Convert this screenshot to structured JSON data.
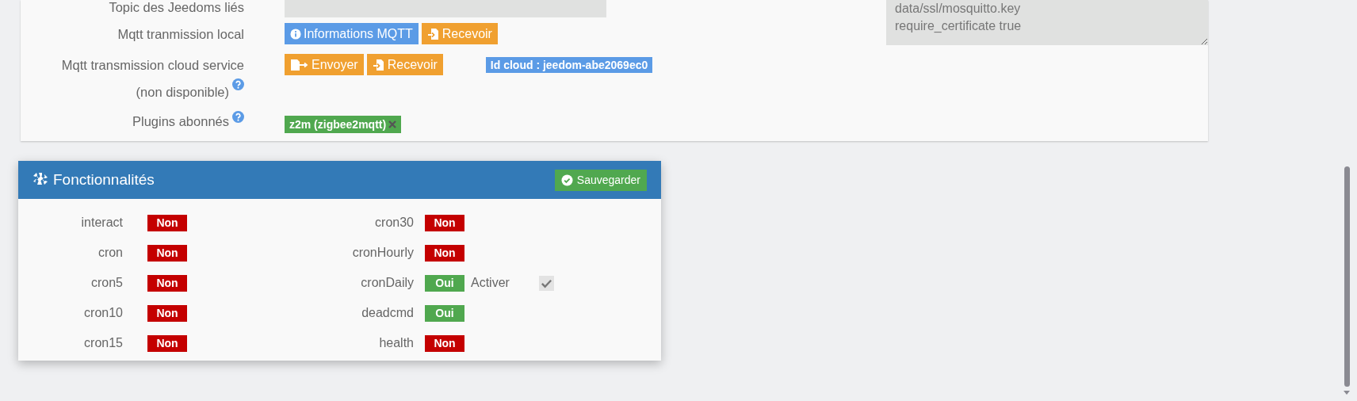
{
  "config": {
    "rows": [
      {
        "kind": "field",
        "label": "Topic des Jeedoms liés"
      },
      {
        "kind": "buttons",
        "label": "Mqtt tranmission local",
        "help": false,
        "buttons": [
          {
            "label": "Informations MQTT",
            "kind": "info"
          },
          {
            "label": "Recevoir",
            "kind": "receive"
          }
        ]
      },
      {
        "kind": "buttons",
        "label": "Mqtt transmission cloud service (non disponible)",
        "help": true,
        "buttons": [
          {
            "label": "Envoyer",
            "kind": "send"
          },
          {
            "label": "Recevoir",
            "kind": "receive"
          }
        ],
        "badge": "Id cloud : jeedom-abe2069ec0"
      },
      {
        "kind": "tags",
        "label": "Plugins abonnés",
        "help": true,
        "tags": [
          "z2m (zigbee2mqtt)"
        ]
      }
    ],
    "textarea": "data/ssl/mosquitto.key\nrequire_certificate true"
  },
  "features": {
    "title": "Fonctionnalités",
    "save_button": "Sauvegarder",
    "columns": [
      [
        {
          "name": "interact",
          "value": "Non",
          "enabled": false
        },
        {
          "name": "cron",
          "value": "Non",
          "enabled": false
        },
        {
          "name": "cron5",
          "value": "Non",
          "enabled": false
        },
        {
          "name": "cron10",
          "value": "Non",
          "enabled": false
        },
        {
          "name": "cron15",
          "value": "Non",
          "enabled": false
        }
      ],
      [
        {
          "name": "cron30",
          "value": "Non",
          "enabled": false
        },
        {
          "name": "cronHourly",
          "value": "Non",
          "enabled": false
        },
        {
          "name": "cronDaily",
          "value": "Oui",
          "enabled": true,
          "activate": {
            "label": "Activer",
            "checked": true
          }
        },
        {
          "name": "deadcmd",
          "value": "Oui",
          "enabled": true
        },
        {
          "name": "health",
          "value": "Non",
          "enabled": false
        }
      ]
    ]
  }
}
